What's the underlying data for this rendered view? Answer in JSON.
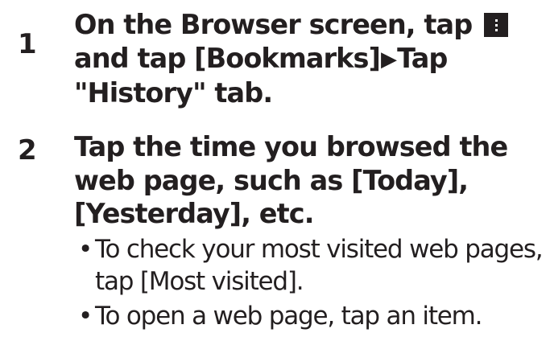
{
  "steps": [
    {
      "number": "1",
      "text_before_icon": "On the Browser screen, tap",
      "text_after_icon": "and tap [Bookmarks]",
      "arrow": "▶",
      "text_after_arrow": "Tap \"History\" tab.",
      "icon": "menu-icon"
    },
    {
      "number": "2",
      "text": "Tap the time you browsed the web page, such as [Today], [Yesterday], etc.",
      "bullets": [
        "To check your most visited web pages, tap [Most visited].",
        "To open a web page, tap an item."
      ],
      "bullet_symbol": "•"
    }
  ]
}
